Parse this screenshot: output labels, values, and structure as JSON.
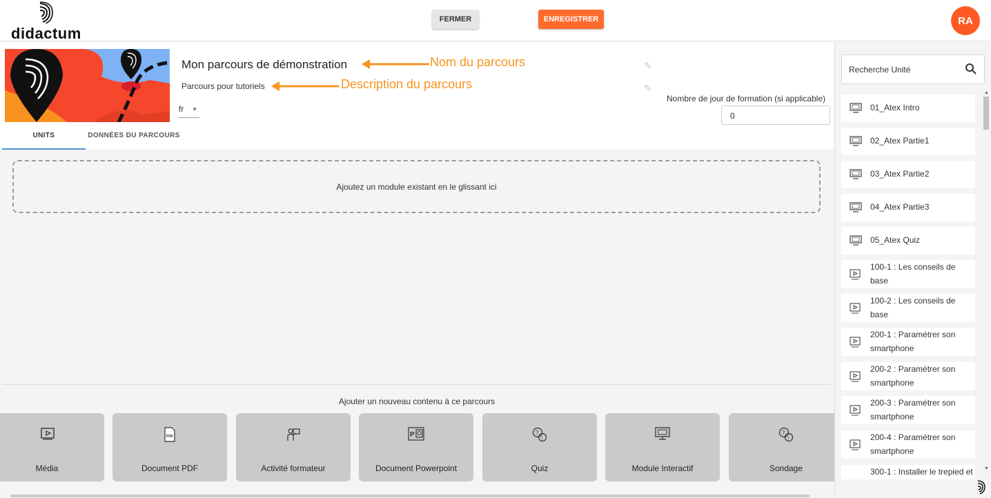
{
  "header": {
    "logo_text": "didactum",
    "close_label": "FERMER",
    "save_label": "ENREGISTRER",
    "avatar_initials": "RA"
  },
  "course": {
    "title": "Mon parcours de démonstration",
    "description": "Parcours pour tutoriels",
    "language": "fr",
    "days_label": "Nombre de jour de formation (si applicable)",
    "days_value": "0"
  },
  "annotations": {
    "name": "Nom du parcours",
    "description": "Description du parcours"
  },
  "tabs": [
    {
      "label": "UNITS",
      "active": true
    },
    {
      "label": "DONNÉES DU PARCOURS",
      "active": false
    }
  ],
  "dropzone": {
    "text": "Ajoutez un module existant en le glissant ici"
  },
  "add_content": {
    "title": "Ajouter un nouveau contenu à ce parcours",
    "tiles": [
      {
        "label": "Média",
        "icon": "play-icon"
      },
      {
        "label": "Document PDF",
        "icon": "pdf-icon"
      },
      {
        "label": "Activité formateur",
        "icon": "trainer-icon"
      },
      {
        "label": "Document Powerpoint",
        "icon": "powerpoint-icon"
      },
      {
        "label": "Quiz",
        "icon": "quiz-icon"
      },
      {
        "label": "Module Interactif",
        "icon": "monitor-icon"
      },
      {
        "label": "Sondage",
        "icon": "survey-icon"
      }
    ]
  },
  "sidebar": {
    "search_placeholder": "Recherche Unité",
    "units": [
      {
        "line1": "01_Atex Intro",
        "icon": "monitor-icon"
      },
      {
        "line1": "02_Atex Partie1",
        "icon": "monitor-icon"
      },
      {
        "line1": "03_Atex Partie2",
        "icon": "monitor-icon"
      },
      {
        "line1": "04_Atex Partie3",
        "icon": "monitor-icon"
      },
      {
        "line1": "05_Atex Quiz",
        "icon": "monitor-icon"
      },
      {
        "line1": "100-1 : Les conseils de",
        "line2": "base",
        "icon": "play-icon"
      },
      {
        "line1": "100-2 : Les conseils de",
        "line2": "base",
        "icon": "play-icon"
      },
      {
        "line1": "200-1 : Paramétrer son",
        "line2": "smartphone",
        "icon": "play-icon"
      },
      {
        "line1": "200-2 : Paramétrer son",
        "line2": "smartphone",
        "icon": "play-icon"
      },
      {
        "line1": "200-3 : Paramétrer son",
        "line2": "smartphone",
        "icon": "play-icon"
      },
      {
        "line1": "200-4 : Paramétrer son",
        "line2": "smartphone",
        "icon": "play-icon"
      },
      {
        "line1": "300-1 : Installer le trepied et",
        "icon": "play-icon"
      }
    ]
  },
  "colors": {
    "accent": "#ff6b2c",
    "annotation": "#f7931e",
    "tab_indicator": "#4a90d9"
  }
}
